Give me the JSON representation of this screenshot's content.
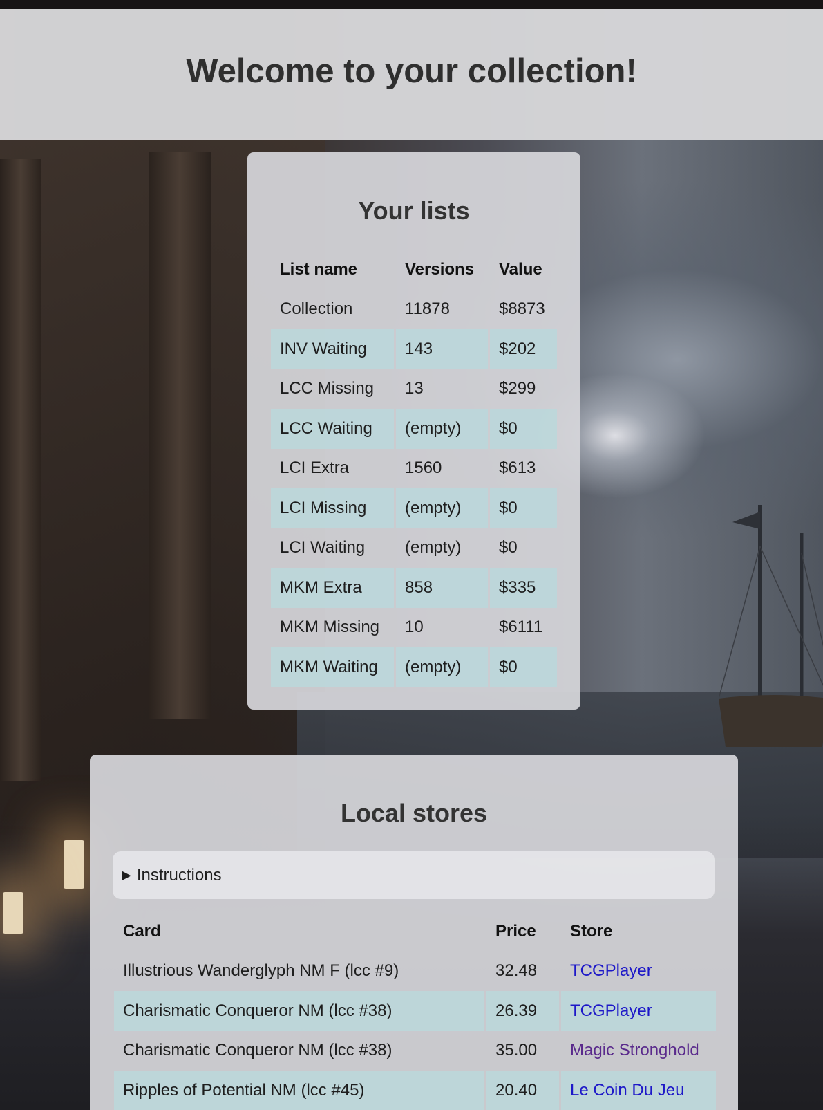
{
  "header": {
    "title": "Welcome to your collection!"
  },
  "lists": {
    "title": "Your lists",
    "columns": [
      "List name",
      "Versions",
      "Value"
    ],
    "rows": [
      {
        "name": "Collection",
        "versions": "11878",
        "value": "$8873"
      },
      {
        "name": "INV Waiting",
        "versions": "143",
        "value": "$202"
      },
      {
        "name": "LCC Missing",
        "versions": "13",
        "value": "$299"
      },
      {
        "name": "LCC Waiting",
        "versions": "(empty)",
        "value": "$0"
      },
      {
        "name": "LCI Extra",
        "versions": "1560",
        "value": "$613"
      },
      {
        "name": "LCI Missing",
        "versions": "(empty)",
        "value": "$0"
      },
      {
        "name": "LCI Waiting",
        "versions": "(empty)",
        "value": "$0"
      },
      {
        "name": "MKM Extra",
        "versions": "858",
        "value": "$335"
      },
      {
        "name": "MKM Missing",
        "versions": "10",
        "value": "$6111"
      },
      {
        "name": "MKM Waiting",
        "versions": "(empty)",
        "value": "$0"
      }
    ]
  },
  "stores": {
    "title": "Local stores",
    "instructions_label": "Instructions",
    "columns": [
      "Card",
      "Price",
      "Store"
    ],
    "rows": [
      {
        "card": "Illustrious Wanderglyph NM F (lcc #9)",
        "price": "32.48",
        "store": "TCGPlayer"
      },
      {
        "card": "Charismatic Conqueror NM (lcc #38)",
        "price": "26.39",
        "store": "TCGPlayer"
      },
      {
        "card": "Charismatic Conqueror NM (lcc #38)",
        "price": "35.00",
        "store": "Magic Stronghold"
      },
      {
        "card": "Ripples of Potential NM (lcc #45)",
        "price": "20.40",
        "store": "Le Coin Du Jeu"
      }
    ]
  },
  "colors": {
    "row_alt": "#bbd7da",
    "link": "#1d18c8",
    "link_visited": "#5a2a8c"
  }
}
